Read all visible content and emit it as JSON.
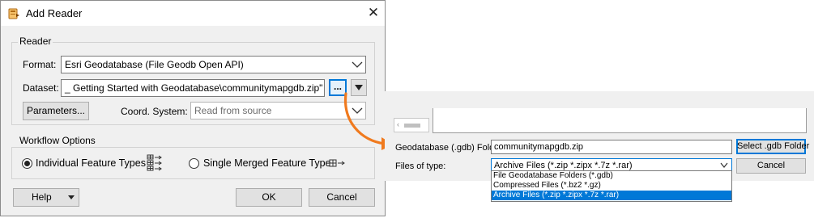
{
  "dialog": {
    "title": "Add Reader",
    "reader_group": "Reader",
    "format_label": "Format:",
    "format_value": "Esri Geodatabase (File Geodb Open API)",
    "dataset_label": "Dataset:",
    "dataset_value": "_ Getting Started with Geodatabase\\communitymapgdb.zip\"",
    "browse_label": "...",
    "parameters_label": "Parameters...",
    "coord_label": "Coord. System:",
    "coord_placeholder": "Read from source",
    "workflow_group": "Workflow Options",
    "option_individual": "Individual Feature Types",
    "option_merged": "Single Merged Feature Type",
    "help_label": "Help",
    "ok_label": "OK",
    "cancel_label": "Cancel"
  },
  "file_dialog": {
    "folder_label": "Geodatabase (.gdb) Folder:",
    "folder_value": "communitymapgdb.zip",
    "select_button": "Select .gdb Folder",
    "type_label": "Files of type:",
    "type_value": "Archive Files (*.zip *.zipx *.7z *.rar)",
    "cancel_label": "Cancel",
    "type_options": [
      "File Geodatabase Folders (*.gdb)",
      "Compressed Files (*.bz2 *.gz)",
      "Archive Files (*.zip *.zipx *.7z *.rar)"
    ]
  },
  "colors": {
    "accent": "#0078d7",
    "arrow": "#f07a1e",
    "dialog_bg": "#f0f0f0"
  }
}
